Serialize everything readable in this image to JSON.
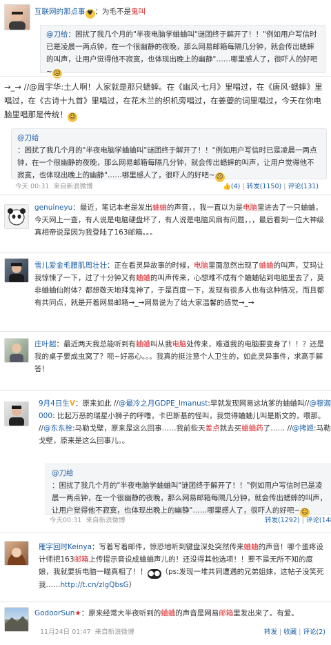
{
  "post1": {
    "name": "互联网的那点事",
    "text_pre": "：为毛不是",
    "text_red": "鬼叫",
    "quote_author": "@刀给",
    "quote_text": "：困扰了我几个月的\"半夜电脑学蛐蛐叫\"谜团终于解开了！！\"例如用户写信时已是凌晨一两点钟，在一个很幽静的夜晚，那么网易邮箱每隔几分钟，就会传出蟋蟀的叫声，让用户觉得他不寂寞，也体现出晚上的幽静\"……哪里感人了，很吓人的好吧~"
  },
  "post2": {
    "lead": "→_→ //@周宇华:土人啊！人家就是那只蟋蟀。在《幽风·七月》里唱过，在《唐风·蟋蟀》里唱过，在《古诗十九首》里唱过，在花木兰的织机旁唱过，在姜夔的词里唱过，今天在你电脑里唱那是传统！",
    "quote_author": "@刀给",
    "quote_text": "：困扰了我几个月的\"半夜电脑学蛐蛐叫\"谜团终于解开了！！\"例如用户写信时已是凌晨一两点钟，在一个很幽静的夜晚，那么网易邮箱每隔几分钟，就会传出蟋蟀的叫声，让用户觉得他不寂寞，也体现出晚上的幽静\"……哪里感人了，很吓人的好吧~",
    "time": "今天 00:31",
    "source": "来自新浪微博",
    "likes": "(4)",
    "repost": "转发(1150)",
    "comments": "评论(131)"
  },
  "post3": {
    "name": "genuineyu",
    "p1": "：最近，笔记本老是发出",
    "r1": "蛐蛐",
    "p2": "的声音，，我一直以为是",
    "r2": "电脑",
    "p3": "里进去了一只蛐蛐，今天网上一查，有人说是电脑硬盘坏了，有人说是电脑风扇有问题，，，最后看到一位大神级真相帝说是因为我登陆了163邮箱。。。"
  },
  "post4": {
    "name": "雪儿爱金毛腰肌周壮壮",
    "p1": "：正在看灵异故事的时候，",
    "r1": "电脑",
    "p2": "里面忽然出现了",
    "r2": "蛐蛐",
    "p3": "的叫声，艾玛让我惊悚了一下，过了十分钟又有",
    "r3": "蛐蛐",
    "p4": "的叫声传来，心想难不成有个蛐蛐钻到电脑里去了，莫非蛐蛐仙附体？都想敬天地拜鬼神了，于是百度一下，发现有很多人也有这种情况，而且都有共同点，就是开着网易邮箱→_→网易说为了给大家温馨的感觉→_→"
  },
  "post5": {
    "name": "庄叶超",
    "p1": "：最近两天我总能听到有",
    "r1": "蛐蛐",
    "p2": "叫从我",
    "r2": "电脑",
    "p3": "处传来，难道我的电脑要变身了！！？还是我的桌子要成虫窝了？呃~好恶心。。。我真的挺注意个人卫生的，如此灵异事件，求高手解答！"
  },
  "post6": {
    "name": "9月4日生",
    "v": "V",
    "p1": "：原来如此 //",
    "b1": "@最冷之月GDPE_lmanust",
    "p2": ":早就发现网易这坑爹的蛐蛐叫//",
    "b2": "@穆迦000",
    "p3": ": 比起万恶的瑞星小狮子的呼噜，卡巴斯基的怪叫，我觉得蛐蛐儿叫是斯文的，喂那。 //",
    "b3": "@东东栓",
    "p4": ":马勒戈壁，原来是这么回事……我前些天",
    "r1": "差点",
    "p5": "就去买",
    "r2": "蛐蛐药",
    "p6": "了…… //",
    "b4": "@拷姬",
    "p7": ":马勒戈壁，原来是这么回事儿。。",
    "quote_author": "@刀给",
    "quote_text": "：困扰了我几个月的\"半夜电脑学蛐蛐叫\"谜团终于解开了！！\"例如用户写信时已是凌晨一两点钟，在一个很幽静的夜晚，那么网易邮箱每隔几分钟，就会传出蟋蟀的叫声，让用户觉得他不寂寞，也体现出晚上的幽静\"……哪里感人了，很吓人的好吧~",
    "time": "今天00:31",
    "source": "来自新浪微博",
    "repost": "转发(1292)",
    "comments": "评论(148"
  },
  "post7": {
    "name": "雁字回时Keinya",
    "p1": "：写着写着邮件，惊恐地听到键盘深处突然传来",
    "r1": "蛐蛐",
    "p2": "的声音！哪个蛋疼设计师把163",
    "r2": "邮箱",
    "p3": "上传提示音设成蛐蛐声儿的！还没得其他选项！！要不是无所不知的度娘，我就要拆电脑一瞄真相了！！",
    "p4": "（ps:发现一堆共同遭遇的兄弟姐妹，这帖子没笑死我……",
    "link": "http://t.cn/zlgQbsG",
    "p5": "）"
  },
  "post8": {
    "name": "GodoorSun",
    "p1": "：原来经常大半夜听到的",
    "r1": "蛐蛐",
    "p2": "的声音是网易",
    "r2": "邮箱",
    "p3": "里发出来了。有爱。",
    "time": "11月24日 01:47",
    "source": "来自新浪微博",
    "repost": "转发",
    "fav": "收藏",
    "comments": "评论(2)"
  },
  "colors": {
    "link": "#1c5ea5",
    "highlight": "#d8262a",
    "quote_bg": "#f4f5f7"
  },
  "icons": {
    "emoji_laugh": "laughing-emoji-icon",
    "emoji_cry": "crying-emoji-icon",
    "like": "thumb-up-icon",
    "verified": "verified-v-icon",
    "heart": "heart-emoji-icon"
  }
}
